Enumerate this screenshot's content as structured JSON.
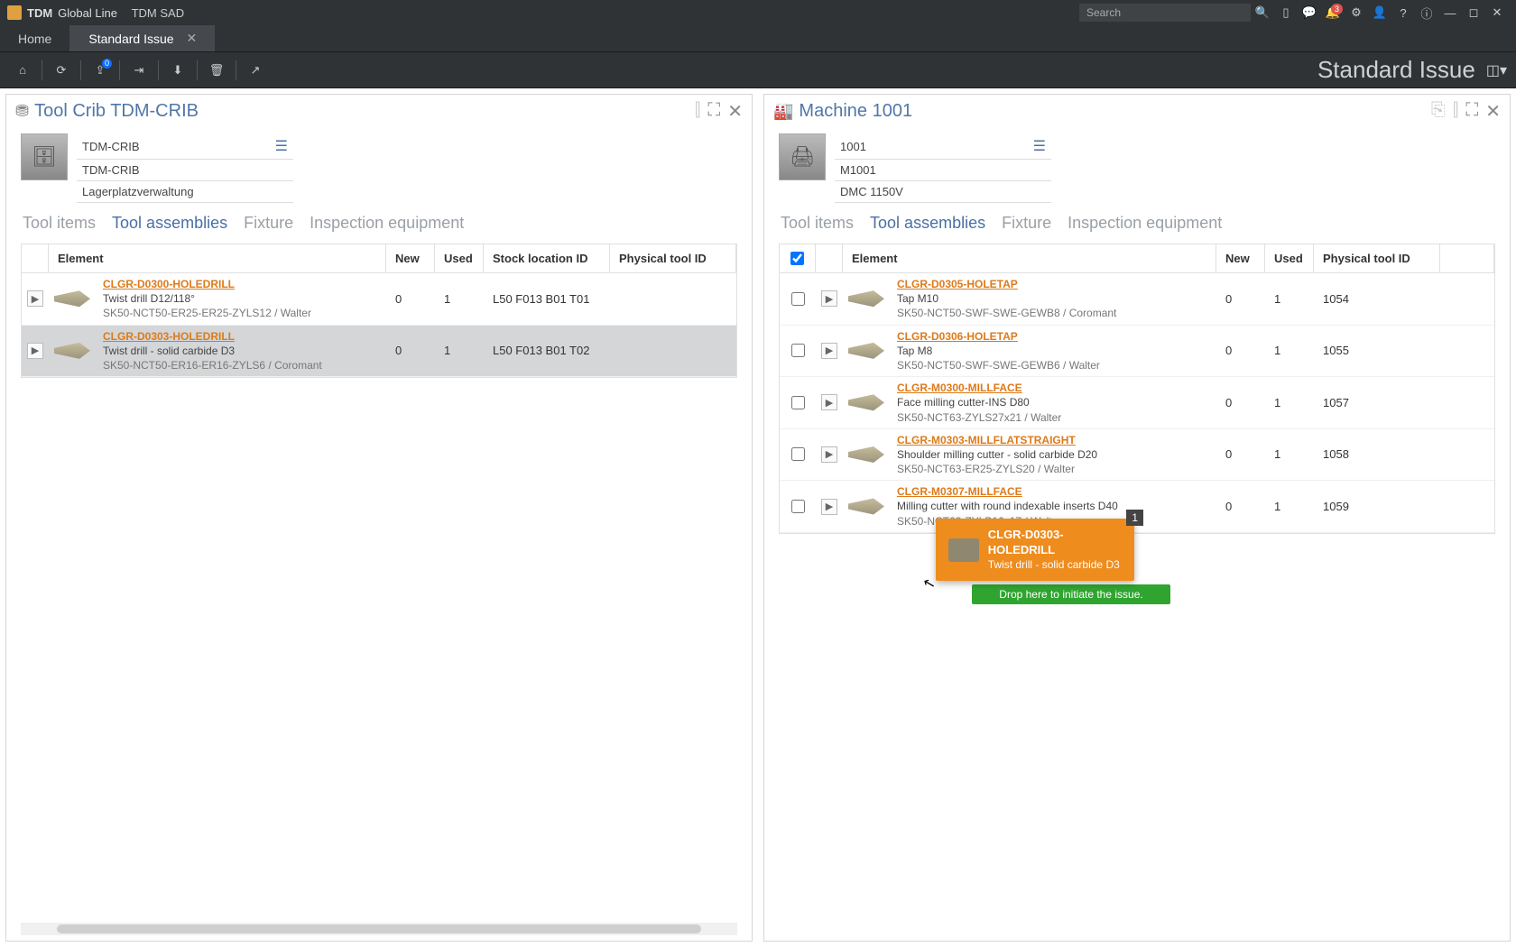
{
  "titlebar": {
    "app": "TDM",
    "product": "Global Line",
    "sub": "TDM SAD",
    "search_placeholder": "Search",
    "notif_count": "3"
  },
  "tabs": {
    "home": "Home",
    "active": "Standard Issue"
  },
  "toolbar_right": "Standard Issue",
  "subtabs": [
    "Tool items",
    "Tool assemblies",
    "Fixture",
    "Inspection equipment"
  ],
  "left_panel": {
    "title": "Tool Crib TDM-CRIB",
    "info": [
      "TDM-CRIB",
      "TDM-CRIB",
      "Lagerplatzverwaltung"
    ],
    "headers": {
      "element": "Element",
      "new": "New",
      "used": "Used",
      "stock": "Stock location ID",
      "phys": "Physical tool ID"
    },
    "rows": [
      {
        "code": "CLGR-D0300-HOLEDRILL",
        "desc": "Twist drill D12/118°",
        "spec": "SK50-NCT50-ER25-ER25-ZYLS12 / Walter",
        "new": "0",
        "used": "1",
        "stock": "L50 F013 B01 T01",
        "phys": "",
        "selected": false
      },
      {
        "code": "CLGR-D0303-HOLEDRILL",
        "desc": "Twist drill - solid carbide D3",
        "spec": "SK50-NCT50-ER16-ER16-ZYLS6 / Coromant",
        "new": "0",
        "used": "1",
        "stock": "L50 F013 B01 T02",
        "phys": "",
        "selected": true
      }
    ]
  },
  "right_panel": {
    "title": "Machine 1001",
    "info": [
      "1001",
      "M1001",
      "DMC 1150V"
    ],
    "headers": {
      "element": "Element",
      "new": "New",
      "used": "Used",
      "phys": "Physical tool ID"
    },
    "rows": [
      {
        "code": "CLGR-D0305-HOLETAP",
        "desc": "Tap M10",
        "spec": "SK50-NCT50-SWF-SWE-GEWB8 / Coromant",
        "new": "0",
        "used": "1",
        "phys": "1054"
      },
      {
        "code": "CLGR-D0306-HOLETAP",
        "desc": "Tap M8",
        "spec": "SK50-NCT50-SWF-SWE-GEWB6 / Walter",
        "new": "0",
        "used": "1",
        "phys": "1055"
      },
      {
        "code": "CLGR-M0300-MILLFACE",
        "desc": "Face milling cutter-INS D80",
        "spec": "SK50-NCT63-ZYLS27x21 / Walter",
        "new": "0",
        "used": "1",
        "phys": "1057"
      },
      {
        "code": "CLGR-M0303-MILLFLATSTRAIGHT",
        "desc": "Shoulder milling cutter - solid carbide D20",
        "spec": "SK50-NCT63-ER25-ZYLS20 / Walter",
        "new": "0",
        "used": "1",
        "phys": "1058"
      },
      {
        "code": "CLGR-M0307-MILLFACE",
        "desc": "Milling cutter with round indexable inserts D40",
        "spec": "SK50-NCT63-ZYLB16x17 / Walter",
        "new": "0",
        "used": "1",
        "phys": "1059"
      }
    ]
  },
  "drag": {
    "count": "1",
    "code": "CLGR-D0303-HOLEDRILL",
    "desc": "Twist drill - solid carbide D3",
    "hint": "Drop here to initiate the issue."
  }
}
